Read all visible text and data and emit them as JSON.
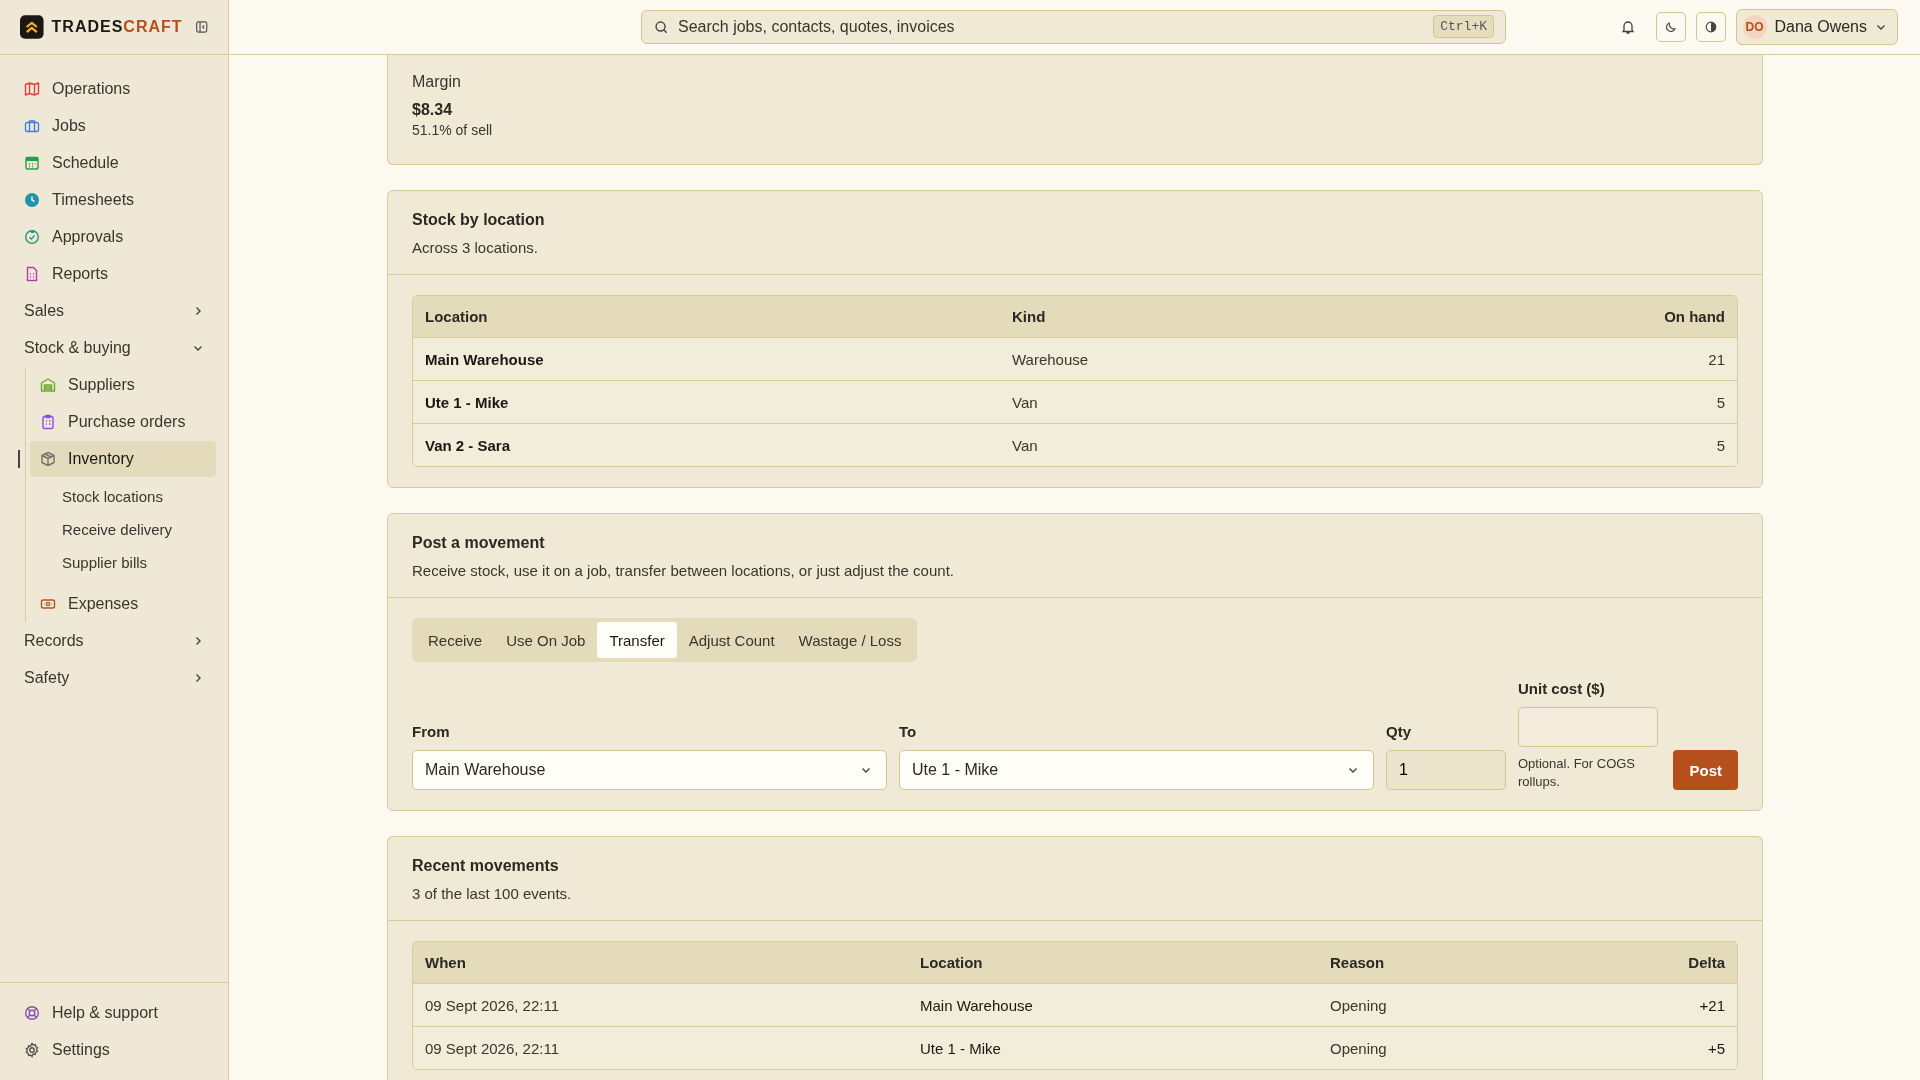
{
  "brand": {
    "part_1": "TRADES",
    "part_2": "CRAFT"
  },
  "sidebar": {
    "items": [
      {
        "kind": "link",
        "label": "Operations",
        "color": "#d9443a",
        "selected": false
      },
      {
        "kind": "link",
        "label": "Jobs",
        "color": "#3f7fe0",
        "selected": false
      },
      {
        "kind": "link",
        "label": "Schedule",
        "color": "#2a9d4a",
        "selected": false
      },
      {
        "kind": "link",
        "label": "Timesheets",
        "color": "#1f93b0",
        "selected": false
      },
      {
        "kind": "link",
        "label": "Approvals",
        "color": "#1f9a7e",
        "selected": false
      },
      {
        "kind": "link",
        "label": "Reports",
        "color": "#b23ab0",
        "selected": false
      },
      {
        "kind": "group",
        "label": "Sales",
        "expanded": false
      },
      {
        "kind": "group",
        "label": "Stock & buying",
        "expanded": true,
        "children": [
          {
            "label": "Suppliers",
            "color": "#6aa82a",
            "selected": false
          },
          {
            "label": "Purchase orders",
            "color": "#8a4fe0",
            "selected": false
          },
          {
            "label": "Inventory",
            "color": "#77716a",
            "selected": true,
            "children": [
              {
                "label": "Stock locations",
                "selected": false
              },
              {
                "label": "Receive delivery",
                "selected": false
              },
              {
                "label": "Supplier bills",
                "selected": false
              }
            ]
          },
          {
            "label": "Expenses",
            "color": "#b0561f",
            "selected": false
          }
        ]
      },
      {
        "kind": "group",
        "label": "Records",
        "expanded": false
      },
      {
        "kind": "group",
        "label": "Safety",
        "expanded": false
      }
    ],
    "footer": [
      {
        "label": "Help & support",
        "color": "#8a4fb0"
      },
      {
        "label": "Settings",
        "color": "#5a5650"
      }
    ]
  },
  "header": {
    "search": {
      "placeholder": "Search jobs, contacts, quotes, invoices",
      "shortcut": "Ctrl+K"
    },
    "user": {
      "initials": "DO",
      "name": "Dana Owens"
    }
  },
  "margin": {
    "label": "Margin",
    "value": "$8.34",
    "note": "51.1% of sell"
  },
  "stock": {
    "title": "Stock by location",
    "subtitle": "Across 3 locations.",
    "columns": [
      "Location",
      "Kind",
      "On hand"
    ],
    "rows": [
      [
        "Main Warehouse",
        "Warehouse",
        "21"
      ],
      [
        "Ute 1 - Mike",
        "Van",
        "5"
      ],
      [
        "Van 2 - Sara",
        "Van",
        "5"
      ]
    ]
  },
  "movement": {
    "title": "Post a movement",
    "subtitle": "Receive stock, use it on a job, transfer between locations, or just adjust the count.",
    "tabs": [
      {
        "label": "Receive",
        "selected": false
      },
      {
        "label": "Use On Job",
        "selected": false
      },
      {
        "label": "Transfer",
        "selected": true
      },
      {
        "label": "Adjust Count",
        "selected": false
      },
      {
        "label": "Wastage / Loss",
        "selected": false
      }
    ],
    "from": {
      "label": "From",
      "value": "Main Warehouse"
    },
    "to": {
      "label": "To",
      "value": "Ute 1 - Mike"
    },
    "qty": {
      "label": "Qty",
      "value": "1"
    },
    "unit_cost": {
      "label": "Unit cost ($)",
      "hint": "Optional. For COGS rollups."
    },
    "post_button": "Post"
  },
  "recent": {
    "title": "Recent movements",
    "subtitle": "3 of the last 100 events.",
    "columns": [
      "When",
      "Location",
      "Reason",
      "Delta"
    ],
    "rows": [
      [
        "09 Sept 2026, 22:11",
        "Main Warehouse",
        "Opening",
        "+21"
      ],
      [
        "09 Sept 2026, 22:11",
        "Ute 1 - Mike",
        "Opening",
        "+5"
      ]
    ]
  }
}
